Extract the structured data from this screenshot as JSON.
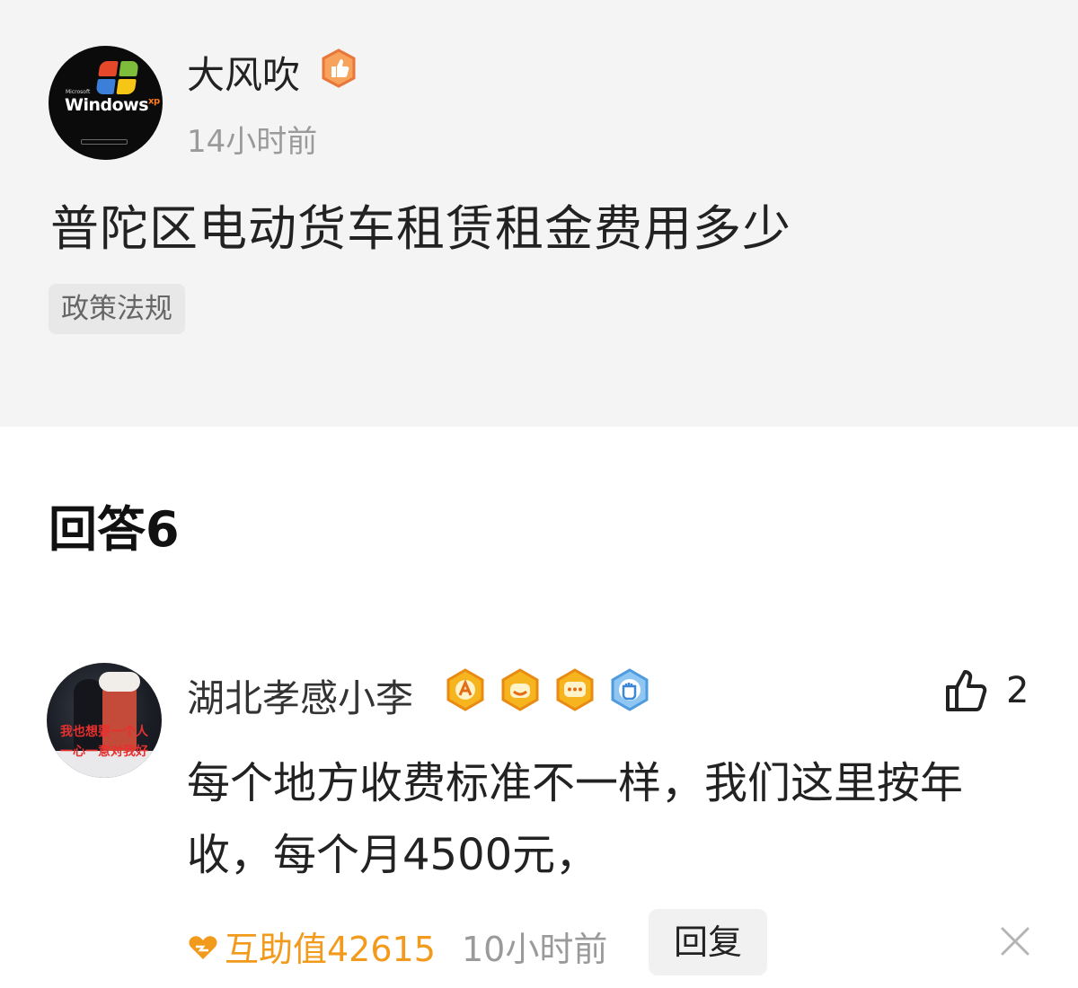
{
  "question": {
    "author": "大风吹",
    "author_badge_icon": "thumbs-up-badge-icon",
    "time": "14小时前",
    "title": "普陀区电动货车租赁租金费用多少",
    "tag": "政策法规",
    "avatar_logo_text": "Windows",
    "avatar_logo_sup": "xp",
    "avatar_logo_small": "Microsoft"
  },
  "answers": {
    "heading": "回答6",
    "items": [
      {
        "author": "湖北孝感小李",
        "badges": [
          "a-letter-badge-icon",
          "smile-badge-icon",
          "chat-badge-icon",
          "fist-badge-icon"
        ],
        "avatar_text_line1": "我也想要一个人",
        "avatar_text_line2": "一心一意对我好",
        "like_icon": "thumbs-up-outline-icon",
        "like_count": "2",
        "body": "每个地方收费标准不一样，我们这里按年收，每个月4500元，",
        "help_label": "互助值42615",
        "time": "10小时前",
        "reply_label": "回复",
        "close_icon": "close-icon"
      }
    ]
  },
  "colors": {
    "question_bg": "#f4f4f4",
    "accent_orange": "#f29a1c",
    "muted_gray": "#9a9a9a",
    "tag_bg": "#e8e8e8"
  }
}
